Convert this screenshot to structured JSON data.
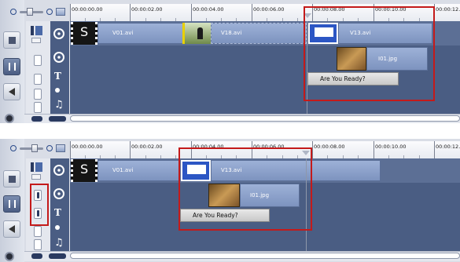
{
  "colors": {
    "highlight_red": "#c41a1a",
    "track_blue": "#4a5d83",
    "clip_blue": "#8ea3cc"
  },
  "panels": [
    {
      "id": "top",
      "ruler": {
        "ticks": [
          "00:00:00.00",
          "00:00:02.00",
          "00:00:04.00",
          "00:00:06.00",
          "00:00:08.00",
          "00:00:10.00",
          "00:00:12.0"
        ]
      },
      "video_clips": [
        "V01.avi",
        "V18.avi",
        "V13.avi"
      ],
      "overlay_clip": "I01.jpg",
      "title_clip": "Are  You Ready?",
      "start_icon_label": "S"
    },
    {
      "id": "bottom",
      "ruler": {
        "ticks": [
          "00:00:00.00",
          "00:00:02.00",
          "00:00:04.00",
          "00:00:06.00",
          "00:00:08.00",
          "00:00:10.00",
          "00:00:12.0"
        ]
      },
      "video_clips": [
        "V01.avi",
        "V13.avi"
      ],
      "overlay_clip": "I01.jpg",
      "title_clip": "Are  You Ready?",
      "start_icon_label": "S"
    }
  ],
  "icons": {
    "zoom_out": "zoom-out-icon",
    "zoom_in": "zoom-in-icon",
    "fit": "fit-to-window-icon",
    "video_track": "film-reel-icon",
    "overlay_track": "overlay-reel-icon",
    "title_track": "title-t-icon",
    "voice_track": "microphone-icon",
    "music_track": "music-note-icon",
    "storyboard_view": "storyboard-view-icon",
    "timeline_view": "timeline-view-icon",
    "audio_view": "audio-view-icon",
    "settings": "gear-icon",
    "ripple": "ripple-edit-icon"
  }
}
